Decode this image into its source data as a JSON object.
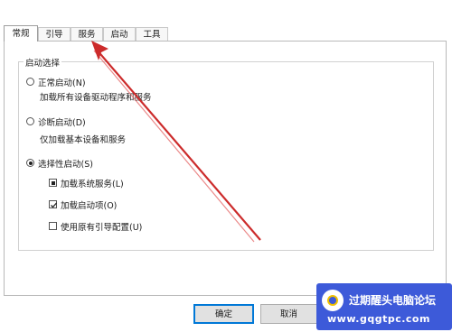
{
  "tabs": [
    "常规",
    "引导",
    "服务",
    "启动",
    "工具"
  ],
  "startup_group": {
    "legend": "启动选择",
    "normal": {
      "label": "正常启动(N)",
      "desc": "加载所有设备驱动程序和服务"
    },
    "diagnostic": {
      "label": "诊断启动(D)",
      "desc": "仅加载基本设备和服务"
    },
    "selective": {
      "label": "选择性启动(S)",
      "options": [
        "加载系统服务(L)",
        "加载启动项(O)",
        "使用原有引导配置(U)"
      ]
    }
  },
  "buttons": {
    "ok": "确定",
    "cancel": "取消"
  },
  "watermark": {
    "title": "过期醒头电脑论坛",
    "url": "www.gqgtpc.com"
  },
  "colors": {
    "arrow": "#cc2b2b",
    "watermark_bg": "#3d5ad9",
    "default_button_border": "#0078d7"
  }
}
